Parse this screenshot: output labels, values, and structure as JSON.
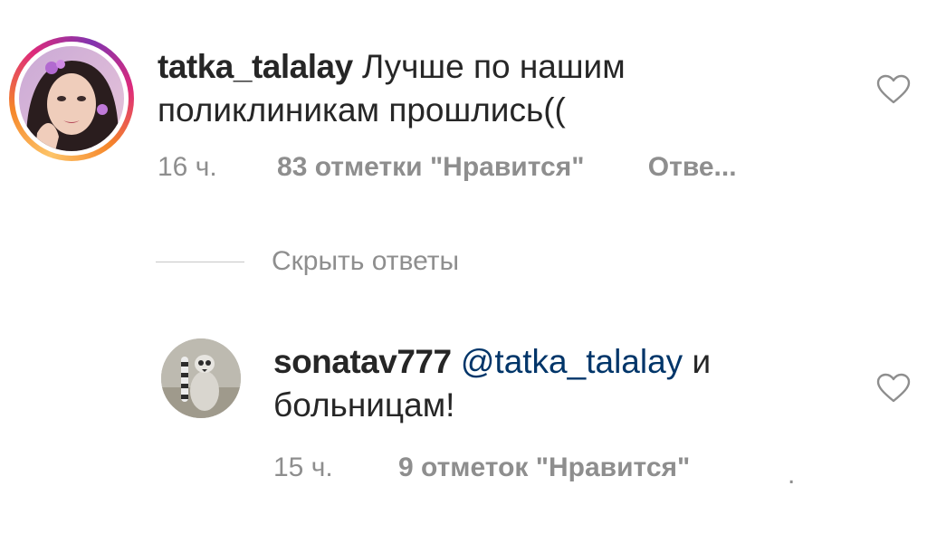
{
  "comments": [
    {
      "username": "tatka_talalay",
      "text": "Лучше по нашим поликлиникам прошлись((",
      "time": "16 ч.",
      "likes": "83 отметки \"Нравится\"",
      "reply": "Отве..."
    },
    {
      "username": "sonatav777",
      "mention": "@tatka_talalay",
      "text_after_mention": "и больницам!",
      "time": "15 ч.",
      "likes": "9 отметок \"Нравится\"",
      "trailing": "."
    }
  ],
  "hide_replies_label": "Скрыть ответы",
  "colors": {
    "text": "#262626",
    "meta": "#8e8e8e",
    "mention": "#003569",
    "divider": "#c7c7c7",
    "heart_stroke": "#8e8e8e",
    "story_ring_start": "#fdc468",
    "story_ring_end": "#8134af"
  },
  "icons": {
    "like": "heart-outline-icon",
    "avatar1": "user-avatar-story-ring",
    "avatar2": "user-avatar-lemur"
  }
}
